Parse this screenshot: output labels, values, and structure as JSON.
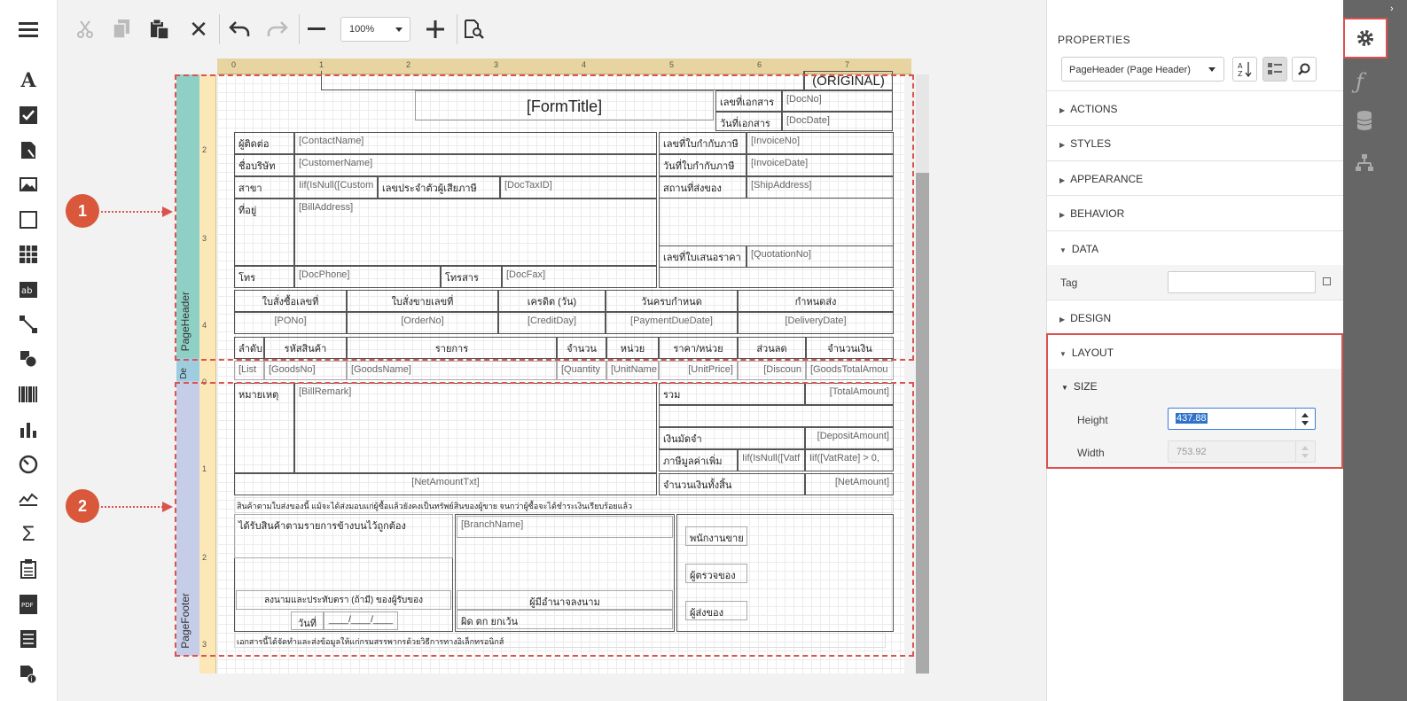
{
  "toolbox": {
    "items": [
      "label",
      "checkbox",
      "rich-text",
      "picture",
      "panel",
      "table",
      "character-comb",
      "line",
      "shape",
      "barcode",
      "chart",
      "gauge",
      "sparkline",
      "summary",
      "subreport",
      "pdf-content",
      "table-of-contents",
      "page-info"
    ]
  },
  "toolbar": {
    "zoom_value": "100%"
  },
  "ruler": {
    "top_ticks": [
      "0",
      "1",
      "2",
      "3",
      "4",
      "5",
      "6",
      "7"
    ],
    "left_header_ticks": [
      "2",
      "3",
      "4"
    ],
    "left_footer_ticks": [
      "0",
      "1",
      "2",
      "3"
    ]
  },
  "bands": {
    "header": "PageHeader",
    "detail": "De",
    "footer": "PageFooter"
  },
  "callouts": {
    "one": "1",
    "two": "2"
  },
  "report": {
    "original": "(ORIGINAL)",
    "form_title": "[FormTitle]",
    "doc_no_label": "เลขที่เอกสาร",
    "doc_no": "[DocNo]",
    "doc_date_label": "วันที่เอกสาร",
    "doc_date": "[DocDate]",
    "contact_label": "ผู้ติดต่อ",
    "contact": "[ContactName]",
    "company_label": "ชื่อบริษัท",
    "company": "[CustomerName]",
    "branch_label": "สาขา",
    "branch": "Iif(IsNull([Custom",
    "taxid_label": "เลขประจำตัวผู้เสียภาษี",
    "taxid": "[DocTaxID]",
    "address_label": "ที่อยู่",
    "address": "[BillAddress]",
    "phone_label": "โทร",
    "phone": "[DocPhone]",
    "fax_label": "โทรสาร",
    "fax": "[DocFax]",
    "invoice_no_label": "เลขที่ใบกำกับภาษี",
    "invoice_no": "[InvoiceNo]",
    "invoice_date_label": "วันที่ใบกำกับภาษี",
    "invoice_date": "[InvoiceDate]",
    "ship_label": "สถานที่ส่งของ",
    "ship": "[ShipAddress]",
    "quotation_label": "เลขที่ใบเสนอราคา",
    "quotation": "[QuotationNo]",
    "order_headers": [
      "ใบสั่งซื้อเลขที่",
      "ใบสั่งขายเลขที่",
      "เครดิต (วัน)",
      "วันครบกำหนด",
      "กำหนดส่ง"
    ],
    "order_values": [
      "[PONo]",
      "[OrderNo]",
      "[CreditDay]",
      "[PaymentDueDate]",
      "[DeliveryDate]"
    ],
    "item_headers": [
      "ลำดับ",
      "รหัสสินค้า",
      "รายการ",
      "จำนวน",
      "หน่วย",
      "ราคา/หน่วย",
      "ส่วนลด",
      "จำนวนเงิน"
    ],
    "detail_values": [
      "[List",
      "[GoodsNo]",
      "[GoodsName]",
      "[Quantity",
      "[UnitName",
      "[UnitPrice]",
      "[Discoun",
      "[GoodsTotalAmou"
    ],
    "remark_label": "หมายเหตุ",
    "remark": "[BillRemark]",
    "total_label": "รวม",
    "total": "[TotalAmount]",
    "deposit_label": "เงินมัดจำ",
    "deposit": "[DepositAmount]",
    "vat_label": "ภาษีมูลค่าเพิ่ม",
    "vat1": "Iif(IsNull([Vatf",
    "vat2": "Iif([VatRate] > 0,",
    "net_txt": "[NetAmountTxt]",
    "net_label": "จำนวนเงินทั้งสิ้น",
    "net": "[NetAmount]",
    "notice": "สินค้าตามใบส่งของนี้ แม้จะได้ส่งมอบแก่ผู้ซื้อแล้วยังคงเป็นทรัพย์สินของผู้ขาย จนกว่าผู้ซื้อจะได้ชำระเงินเรียบร้อยแล้ว",
    "received_label": "ได้รับสินค้าตามรายการข้างบนไว้ถูกต้อง",
    "sign_label": "ลงนามและประทับตรา (ถ้ามี) ของผู้รับของ",
    "date_label": "วันที่",
    "date_blank": "____/____/____",
    "branch_name": "[BranchName]",
    "authorized": "ผู้มีอำนาจลงนาม",
    "eoe": "ผิด ตก ยกเว้น",
    "salesperson": "พนักงานขาย",
    "checker": "ผู้ตรวจของ",
    "sender": "ผู้ส่งของ",
    "footer_note": "เอกสารนี้ได้จัดทำและส่งข้อมูลให้แก่กรมสรรพากรด้วยวิธีการทางอิเล็กทรอนิกส์"
  },
  "properties": {
    "title": "PROPERTIES",
    "selected": "PageHeader (Page Header)",
    "sections": [
      "ACTIONS",
      "STYLES",
      "APPEARANCE",
      "BEHAVIOR"
    ],
    "data_section": "DATA",
    "tag_label": "Tag",
    "tag_value": "",
    "design_section": "DESIGN",
    "layout_section": "LAYOUT",
    "size_section": "SIZE",
    "height_label": "Height",
    "height_value": "437.88",
    "width_label": "Width",
    "width_value": "753.92"
  },
  "colors": {
    "accent": "#d9534f",
    "header_band": "#8fd0c6",
    "footer_band": "#c5cde8",
    "rail": "#666666"
  }
}
